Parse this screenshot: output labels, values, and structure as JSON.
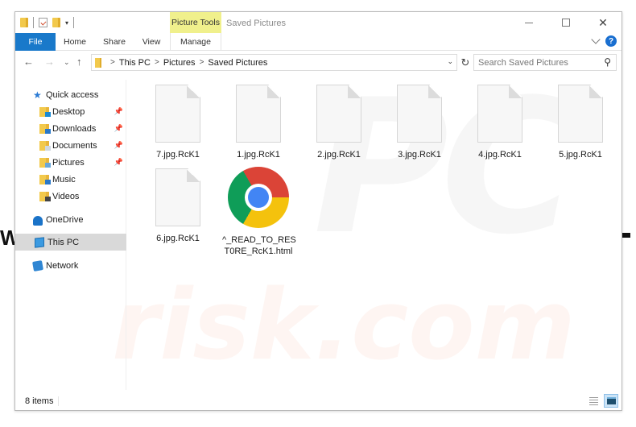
{
  "window": {
    "title": "Saved Pictures",
    "contextual_tab_group": "Picture Tools",
    "controls": {
      "minimize": "minimize",
      "maximize": "maximize",
      "close": "✕"
    }
  },
  "ribbon": {
    "tabs": [
      {
        "label": "File",
        "active": true
      },
      {
        "label": "Home"
      },
      {
        "label": "Share"
      },
      {
        "label": "View"
      },
      {
        "label": "Manage"
      }
    ],
    "help": "?"
  },
  "navigation": {
    "back": "←",
    "forward": "→",
    "recent": "⌄",
    "up": "↑",
    "breadcrumb": [
      "This PC",
      "Pictures",
      "Saved Pictures"
    ],
    "refresh": "↻",
    "search_placeholder": "Search Saved Pictures"
  },
  "sidebar": {
    "items": [
      {
        "label": "Quick access",
        "icon": "star-icon"
      },
      {
        "label": "Desktop",
        "icon": "desktop-folder-icon",
        "pinned": true
      },
      {
        "label": "Downloads",
        "icon": "downloads-folder-icon",
        "pinned": true
      },
      {
        "label": "Documents",
        "icon": "documents-folder-icon",
        "pinned": true
      },
      {
        "label": "Pictures",
        "icon": "pictures-folder-icon",
        "pinned": true
      },
      {
        "label": "Music",
        "icon": "music-folder-icon"
      },
      {
        "label": "Videos",
        "icon": "videos-folder-icon"
      },
      {
        "label": "OneDrive",
        "icon": "onedrive-icon"
      },
      {
        "label": "This PC",
        "icon": "this-pc-icon",
        "selected": true
      },
      {
        "label": "Network",
        "icon": "network-icon"
      }
    ]
  },
  "files": [
    {
      "name": "7.jpg.RcK1",
      "type": "generic"
    },
    {
      "name": "1.jpg.RcK1",
      "type": "generic"
    },
    {
      "name": "2.jpg.RcK1",
      "type": "generic"
    },
    {
      "name": "3.jpg.RcK1",
      "type": "generic"
    },
    {
      "name": "4.jpg.RcK1",
      "type": "generic"
    },
    {
      "name": "5.jpg.RcK1",
      "type": "generic"
    },
    {
      "name": "6.jpg.RcK1",
      "type": "generic"
    },
    {
      "name": "^_READ_TO_RES T0RE_RcK1.html",
      "type": "chrome-html"
    }
  ],
  "status": {
    "item_count": "8 items"
  },
  "watermark": {
    "top": "PC",
    "bottom": "risk.com"
  },
  "colors": {
    "file_tab": "#1979ca",
    "picture_tools": "#f0f08c",
    "selected_nav": "#d9d9d9"
  }
}
